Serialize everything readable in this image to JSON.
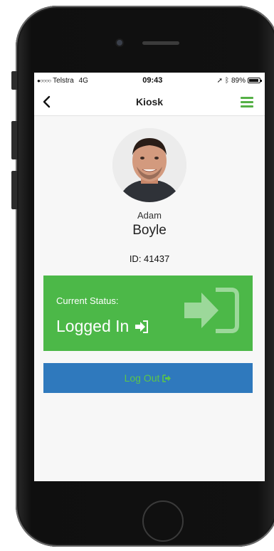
{
  "statusbar": {
    "carrier": "Telstra",
    "network": "4G",
    "time": "09:43",
    "battery": "89%"
  },
  "navbar": {
    "title": "Kiosk",
    "back_icon": "chevron-left-icon",
    "menu_icon": "hamburger-menu-icon"
  },
  "profile": {
    "first_name": "Adam",
    "last_name": "Boyle",
    "id_text": "ID: 41437"
  },
  "status": {
    "caption": "Current Status:",
    "value": "Logged In",
    "icon": "sign-in-icon"
  },
  "logout": {
    "label": "Log Out",
    "icon": "sign-out-icon"
  },
  "colors": {
    "status_green": "#4cb848",
    "logout_blue": "#2f79bd",
    "accent_green": "#55b046"
  }
}
